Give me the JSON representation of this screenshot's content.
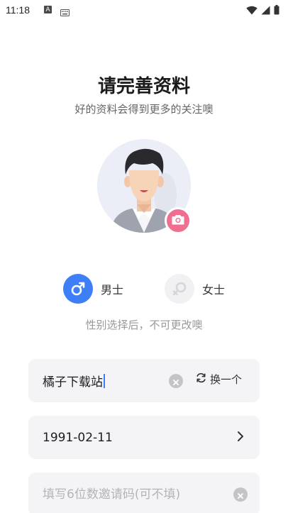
{
  "status_bar": {
    "time": "11:18",
    "input_badge": "A",
    "icons": [
      "text-input-icon",
      "keyboard-icon",
      "wifi-icon",
      "signal-icon",
      "battery-icon"
    ]
  },
  "header": {
    "title": "请完善资料",
    "subtitle": "好的资料会得到更多的关注噢"
  },
  "avatar": {
    "icon": "camera-icon",
    "badge_color": "#f06e90"
  },
  "gender": {
    "options": [
      {
        "label": "男士",
        "icon": "male-icon",
        "selected": true
      },
      {
        "label": "女士",
        "icon": "female-icon",
        "selected": false
      }
    ],
    "hint": "性别选择后，不可更改噢",
    "accent": "#3e7ef6"
  },
  "form": {
    "nickname": {
      "value": "橘子下载站",
      "swap_label": "换一个"
    },
    "birthday": {
      "value": "1991-02-11"
    },
    "invite_code": {
      "value": "",
      "placeholder": "填写6位数邀请码(可不填)"
    }
  }
}
